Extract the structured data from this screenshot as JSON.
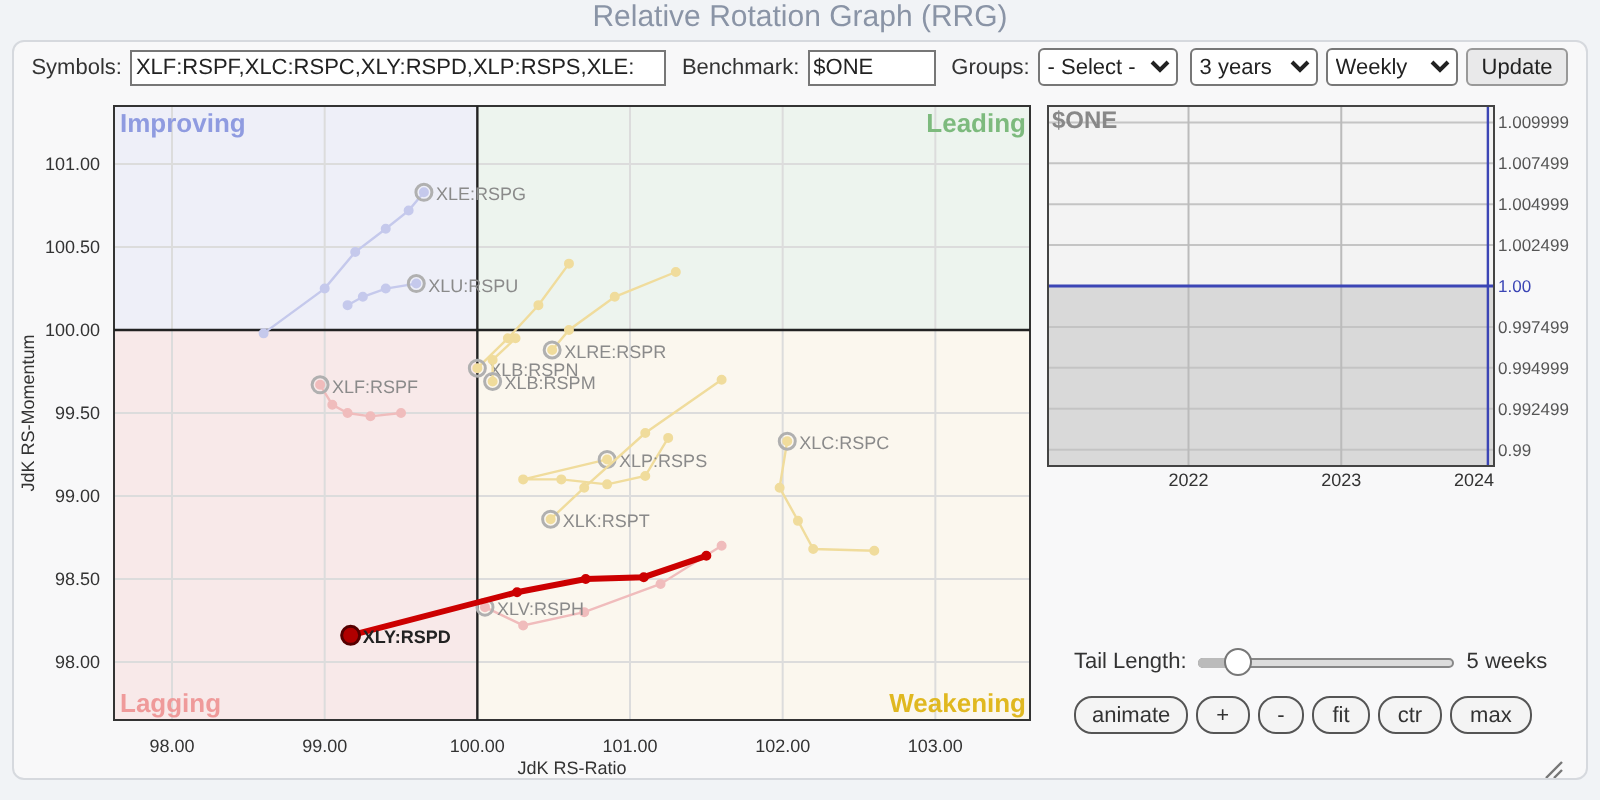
{
  "page_title": "Relative Rotation Graph (RRG)",
  "toolbar": {
    "symbols_label": "Symbols:",
    "symbols_value": "XLF:RSPF,XLC:RSPC,XLY:RSPD,XLP:RSPS,XLE:",
    "benchmark_label": "Benchmark:",
    "benchmark_value": "$ONE",
    "groups_label": "Groups:",
    "groups_value": "- Select -",
    "period_value": "3 years",
    "interval_value": "Weekly",
    "update_button": "Update"
  },
  "rrg": {
    "chart_data": {
      "type": "scatter",
      "xlabel": "JdK RS-Ratio",
      "ylabel": "JdK RS-Momentum",
      "xlim": [
        97.62,
        103.62
      ],
      "ylim": [
        97.65,
        101.35
      ],
      "grid": true,
      "xticks": [
        {
          "value": 98,
          "label": "98.00"
        },
        {
          "value": 99,
          "label": "99.00"
        },
        {
          "value": 100,
          "label": "100.00"
        },
        {
          "value": 101,
          "label": "101.00"
        },
        {
          "value": 102,
          "label": "102.00"
        },
        {
          "value": 103,
          "label": "103.00"
        }
      ],
      "yticks": [
        {
          "value": 98,
          "label": "98.00"
        },
        {
          "value": 98.5,
          "label": "98.50"
        },
        {
          "value": 99,
          "label": "99.00"
        },
        {
          "value": 99.5,
          "label": "99.50"
        },
        {
          "value": 100,
          "label": "100.00"
        },
        {
          "value": 100.5,
          "label": "100.50"
        },
        {
          "value": 101,
          "label": "101.00"
        }
      ],
      "annotations": [
        "Improving",
        "Leading",
        "Lagging",
        "Weakening"
      ],
      "series": [
        {
          "name": "XLE:RSPG",
          "color": "#c5c9ec",
          "x": [
            98.6,
            99.0,
            99.2,
            99.4,
            99.55,
            99.65
          ],
          "values": [
            99.98,
            100.25,
            100.47,
            100.61,
            100.72,
            100.83
          ]
        },
        {
          "name": "XLU:RSPU",
          "color": "#c5c9ec",
          "x": [
            99.15,
            99.25,
            99.4,
            99.6
          ],
          "values": [
            100.15,
            100.2,
            100.25,
            100.28
          ]
        },
        {
          "name": "XLF:RSPF",
          "color": "#f0bcbc",
          "x": [
            99.5,
            99.3,
            99.15,
            99.05,
            98.97
          ],
          "values": [
            99.5,
            99.48,
            99.5,
            99.55,
            99.67
          ]
        },
        {
          "name": "XLRE:RSPR",
          "color": "#f0dc9c",
          "x": [
            101.3,
            100.9,
            100.6,
            100.49
          ],
          "values": [
            100.35,
            100.2,
            100.0,
            99.88
          ]
        },
        {
          "name": "XLB:RSPN",
          "color": "#f0dc9c",
          "x": [
            100.6,
            100.4,
            100.2,
            100.0
          ],
          "values": [
            100.4,
            100.15,
            99.95,
            99.77
          ]
        },
        {
          "name": "XLB:RSPM",
          "color": "#f0dc9c",
          "x": [
            100.25,
            100.1,
            100.1
          ],
          "values": [
            99.95,
            99.82,
            99.69
          ]
        },
        {
          "name": "XLP:RSPS",
          "color": "#f0dc9c",
          "x": [
            101.25,
            101.1,
            100.85,
            100.55,
            100.3,
            100.85
          ],
          "values": [
            99.35,
            99.12,
            99.07,
            99.1,
            99.1,
            99.22
          ]
        },
        {
          "name": "XLK:RSPT",
          "color": "#f0dc9c",
          "x": [
            101.6,
            101.1,
            100.7,
            100.48
          ],
          "values": [
            99.7,
            99.38,
            99.05,
            98.86
          ]
        },
        {
          "name": "XLC:RSPC",
          "color": "#f0dc9c",
          "x": [
            102.6,
            102.2,
            102.1,
            101.98,
            102.03
          ],
          "values": [
            98.67,
            98.68,
            98.85,
            99.05,
            99.33
          ]
        },
        {
          "name": "XLV:RSPH",
          "color": "#f0bcbc",
          "x": [
            101.6,
            101.2,
            100.7,
            100.3,
            100.05
          ],
          "values": [
            98.7,
            98.47,
            98.3,
            98.22,
            98.33
          ]
        },
        {
          "name": "XLY:RSPD",
          "color": "#cc0000",
          "x": [
            101.5,
            101.09,
            100.71,
            100.26,
            99.17
          ],
          "values": [
            98.64,
            98.51,
            98.5,
            98.42,
            98.16
          ]
        }
      ]
    }
  },
  "benchmark_chart": {
    "chart_data": {
      "type": "area",
      "x": [
        2021.08,
        2024.0
      ],
      "xlim": [
        2021.08,
        2024.0
      ],
      "ylim": [
        0.989,
        1.011
      ],
      "grid": true,
      "xticks": [
        {
          "value": 2022,
          "label": "2022"
        },
        {
          "value": 2023,
          "label": "2023"
        },
        {
          "value": 2024,
          "label": "2024"
        }
      ],
      "yticks": [
        {
          "value": 1.009999,
          "label": "1.009999"
        },
        {
          "value": 1.007499,
          "label": "1.007499"
        },
        {
          "value": 1.004999,
          "label": "1.004999"
        },
        {
          "value": 1.002499,
          "label": "1.002499"
        },
        {
          "value": 1.0,
          "label": "1.00"
        },
        {
          "value": 0.997499,
          "label": "0.997499"
        },
        {
          "value": 0.994999,
          "label": "0.994999"
        },
        {
          "value": 0.992499,
          "label": "0.992499"
        },
        {
          "value": 0.99,
          "label": "0.99"
        }
      ],
      "ref_lines": [
        {
          "axis": "x",
          "value": 2023.96,
          "color": "#3b45b5"
        }
      ],
      "series": [
        {
          "name": "$ONE",
          "color": "#3b45b5",
          "values": [
            1.0,
            1.0
          ]
        }
      ]
    }
  },
  "tail": {
    "label": "Tail Length:",
    "level": 0.15,
    "reading": "5 weeks"
  },
  "buttons": [
    "animate",
    "+",
    "-",
    "fit",
    "ctr",
    "max"
  ]
}
